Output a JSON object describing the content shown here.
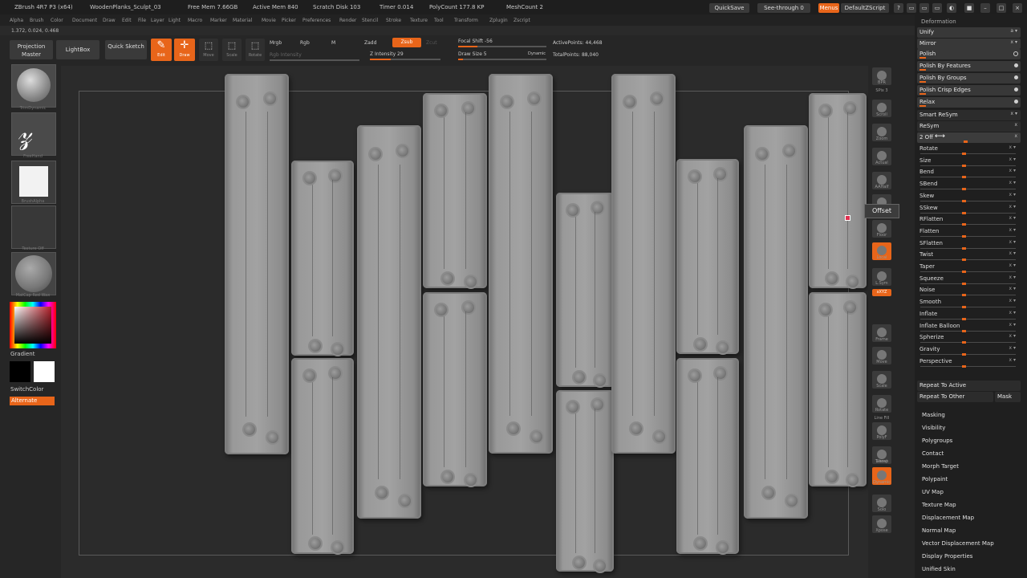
{
  "title_bar": {
    "app": "ZBrush 4R7 P3 (x64)",
    "doc": "WoodenPlanks_Sculpt_03",
    "free_mem": "Free Mem 7.66GB",
    "active_mem": "Active Mem 840",
    "scratch": "Scratch Disk 103",
    "timer": "Timer 0.014",
    "polycount": "PolyCount 177.8 KP",
    "meshcount": "MeshCount 2",
    "quicksave": "QuickSave",
    "seethrough": "See-through 0",
    "menus": "Menus",
    "script": "DefaultZScript"
  },
  "menu_items": [
    "Alpha",
    "Brush",
    "Color",
    "Document",
    "Draw",
    "Edit",
    "File",
    "Layer",
    "Light",
    "Macro",
    "Marker",
    "Material",
    "Movie",
    "Picker",
    "Preferences",
    "Render",
    "Stencil",
    "Stroke",
    "Texture",
    "Tool",
    "Transform",
    "Zplugin",
    "Zscript"
  ],
  "coords": "1.372, 0.024, 0.468",
  "toolbar": {
    "projection_master": "Projection Master",
    "lightbox": "LightBox",
    "quick_sketch": "Quick Sketch",
    "edit": "Edit",
    "draw": "Draw",
    "move": "Move",
    "scale": "Scale",
    "rotate": "Rotate",
    "mrgb": "Mrgb",
    "rgb": "Rgb",
    "m": "M",
    "zadd": "Zadd",
    "zsub": "Zsub",
    "zcut": "Zcut",
    "rgb_intensity": "Rgb Intensity",
    "z_intensity": "Z Intensity 29",
    "focal_shift": "Focal Shift -56",
    "draw_size": "Draw Size 5",
    "dynamic": "Dynamic",
    "active_points": "ActivePoints: 44,468",
    "total_points": "TotalPoints: 88,040",
    "z_intensity_level": 0.29,
    "focal_shift_level": 0.22,
    "draw_size_level": 0.05
  },
  "left_shelf": {
    "brush_caption": "TrimDynamic",
    "stroke_caption": "FreeHand",
    "alpha_caption": "BrushAlpha",
    "texture_caption": "Texture Off",
    "material_caption": "MatCap Red Wax",
    "gradient": "Gradient",
    "switchcolor": "SwitchColor",
    "alternate": "Alternate"
  },
  "right_shelf": {
    "bpr": "BPR",
    "spix": "SPix 3",
    "scroll": "Scroll",
    "zoom": "Zoom",
    "actual": "Actual",
    "aahalf": "AAHalf",
    "persp": "Persp",
    "floor": "Floor",
    "local": "Local",
    "lsym": "L.Sym",
    "xyz": "xXYZ",
    "frame": "Frame",
    "move": "Move",
    "scale": "Scale",
    "rotate": "Rotate",
    "linefill": "Line Fill",
    "polyf": "PolyF",
    "transp": "Transp",
    "ghost": "Ghost",
    "dynamic": "Dynamic",
    "solo": "Solo",
    "xpose": "Xpose"
  },
  "tooltip": "Offset",
  "panel": {
    "header": "Deformation",
    "unify": "Unify",
    "mirror": "Mirror",
    "polish": "Polish",
    "polish_by_features": "Polish By Features",
    "polish_by_groups": "Polish By Groups",
    "polish_crisp": "Polish Crisp Edges",
    "relax": "Relax",
    "smart_resym": "Smart ReSym",
    "resym": "ReSym",
    "offset": "2 Off",
    "sliders": [
      "Rotate",
      "Size",
      "Bend",
      "SBend",
      "Skew",
      "SSkew",
      "RFlatten",
      "Flatten",
      "SFlatten",
      "Twist",
      "Taper",
      "Squeeze",
      "Noise",
      "Smooth",
      "Inflate",
      "Inflate Balloon",
      "Spherize",
      "Gravity",
      "Perspective"
    ],
    "repeat_active": "Repeat To Active",
    "repeat_other": "Repeat To Other",
    "mask": "Mask",
    "subpalettes": [
      "Masking",
      "Visibility",
      "Polygroups",
      "Contact",
      "Morph Target",
      "Polypaint",
      "UV Map",
      "Texture Map",
      "Displacement Map",
      "Normal Map",
      "Vector Displacement Map",
      "Display Properties",
      "Unified Skin"
    ]
  },
  "colors": {
    "accent": "#e8651a",
    "primary": "#000000",
    "secondary": "#ffffff"
  }
}
